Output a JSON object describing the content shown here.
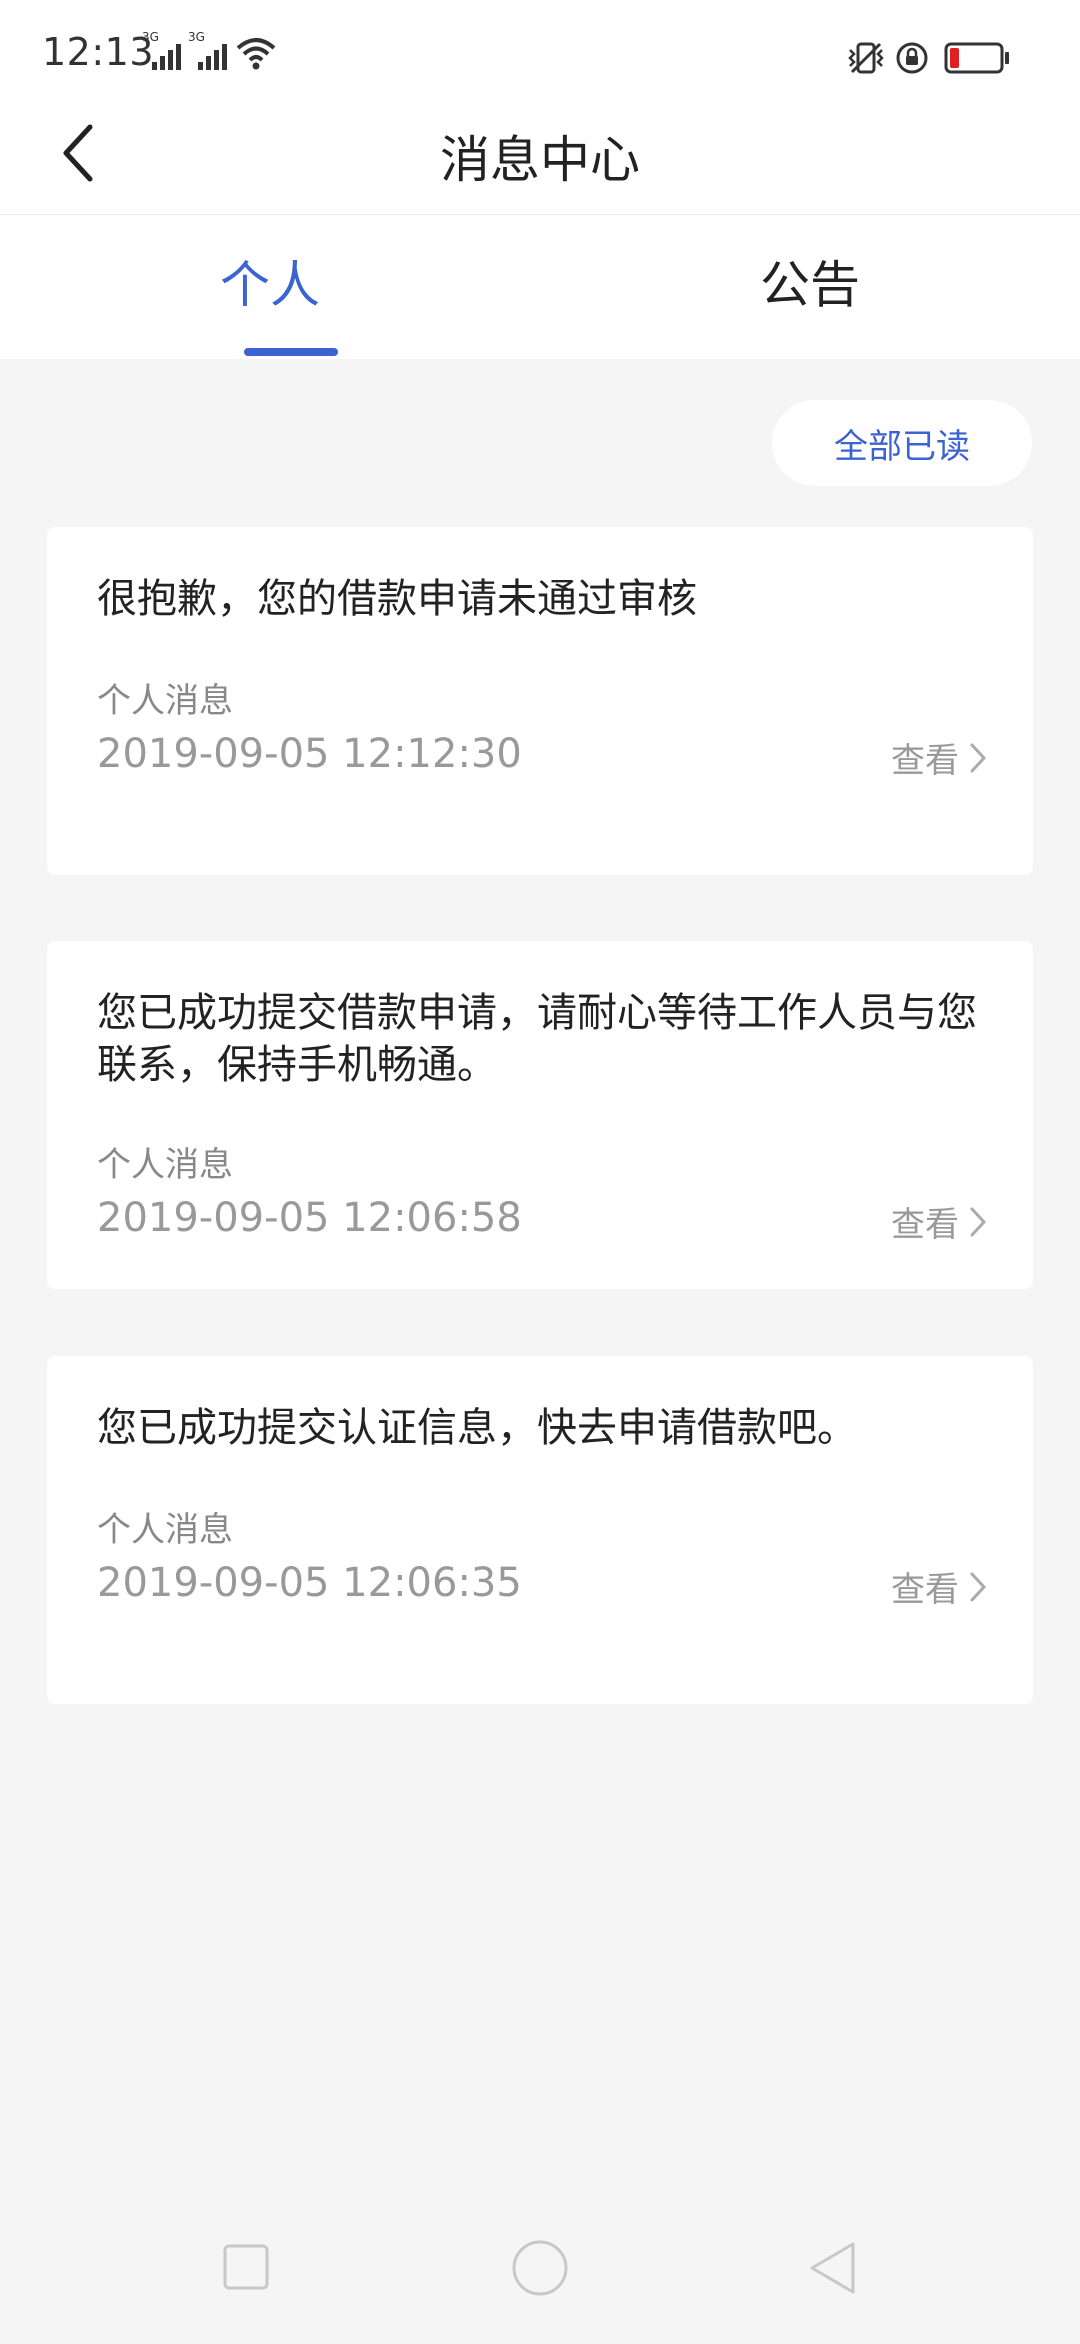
{
  "status_bar": {
    "time": "12:13",
    "network_1": "3G",
    "network_2": "3G"
  },
  "header": {
    "title": "消息中心"
  },
  "tabs": [
    {
      "label": "个人",
      "active": true
    },
    {
      "label": "公告",
      "active": false
    }
  ],
  "actions": {
    "mark_all_read": "全部已读"
  },
  "messages": [
    {
      "title": "很抱歉，您的借款申请未通过审核",
      "type": "个人消息",
      "time": "2019-09-05 12:12:30",
      "action": "查看"
    },
    {
      "title": "您已成功提交借款申请，请耐心等待工作人员与您联系，保持手机畅通。",
      "type": "个人消息",
      "time": "2019-09-05 12:06:58",
      "action": "查看"
    },
    {
      "title": "您已成功提交认证信息，快去申请借款吧。",
      "type": "个人消息",
      "time": "2019-09-05 12:06:35",
      "action": "查看"
    }
  ],
  "colors": {
    "accent": "#3b63d1",
    "background": "#f5f5f5",
    "card": "#ffffff",
    "battery_low": "#e02020"
  },
  "icons": {
    "back": "chevron-left-icon",
    "view": "chevron-right-icon",
    "nav_recent": "square-icon",
    "nav_home": "circle-icon",
    "nav_back": "triangle-back-icon"
  }
}
